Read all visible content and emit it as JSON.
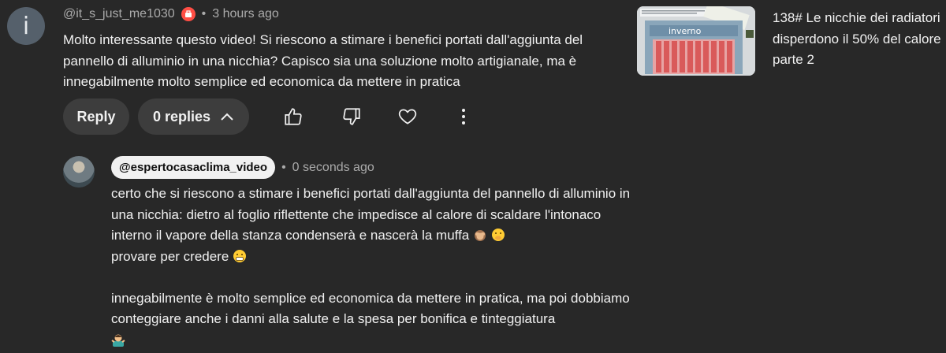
{
  "comment": {
    "avatar_letter": "i",
    "handle": "@it_s_just_me1030",
    "separator": "•",
    "time": "3 hours ago",
    "text": "Molto interessante questo video! Si riescono a stimare i benefici portati dall'aggiunta del pannello di alluminio in una nicchia? Capisco sia una soluzione molto artigianale, ma è innegabilmente molto semplice ed economica da mettere in pratica"
  },
  "actions": {
    "reply_label": "Reply",
    "replies_label": "0 replies"
  },
  "reply": {
    "handle": "@espertocasaclima_video",
    "separator": "•",
    "time": "0 seconds ago",
    "paragraph1": "certo che si riescono a stimare i benefici portati dall'aggiunta del pannello di alluminio in una nicchia: dietro al foglio riflettente che impedisce al calore di scaldare l'intonaco interno il vapore della stanza condenserà e nascerà la muffa",
    "line2": "provare per credere",
    "paragraph2": "innegabilmente è molto semplice ed economica da mettere in pratica, ma poi dobbiamo conteggiare anche i danni alla salute e la spesa per bonifica e tinteggiatura"
  },
  "video": {
    "thumb_label": "inverno",
    "title": "138# Le nicchie dei radiatori disperdono il 50% del calore parte 2"
  },
  "colors": {
    "background": "#282828",
    "pill": "#3d3d3d",
    "badge": "#ff4e45",
    "radiator": "#d95a5a"
  }
}
